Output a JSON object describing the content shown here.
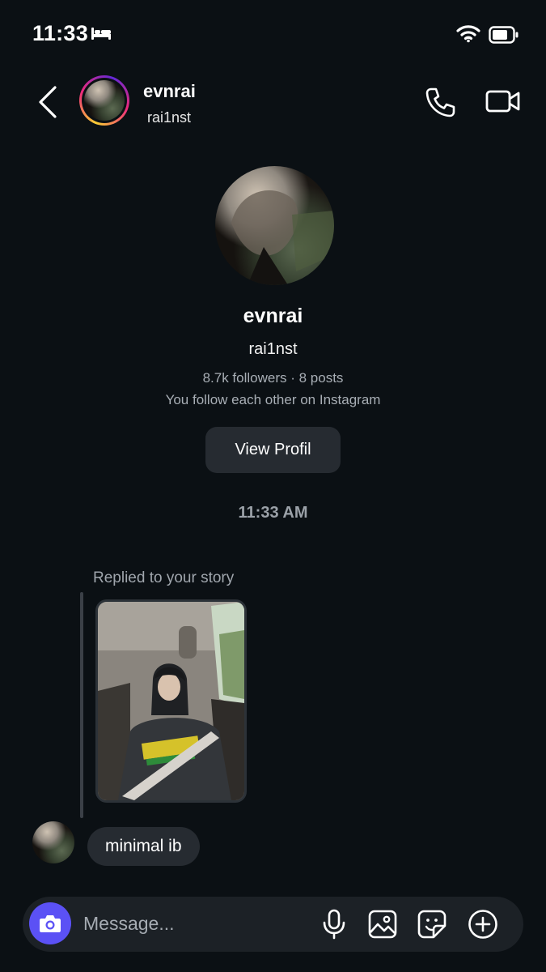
{
  "status_bar": {
    "time": "11:33",
    "icons": [
      "bed-icon",
      "wifi-icon",
      "battery-icon"
    ]
  },
  "header": {
    "back_icon": "chevron-left-icon",
    "name": "evnrai",
    "username": "rai1nst",
    "actions": [
      "phone-icon",
      "video-camera-icon"
    ]
  },
  "profile": {
    "name": "evnrai",
    "username": "rai1nst",
    "stats": "8.7k followers · 8 posts",
    "mutual": "You follow each other on Instagram",
    "view_profile_label": "View Profil"
  },
  "conversation": {
    "timestamp": "11:33 AM",
    "reply_label": "Replied to your story",
    "message": "minimal ib"
  },
  "composer": {
    "placeholder": "Message...",
    "icons": [
      "camera-icon",
      "microphone-icon",
      "gallery-icon",
      "sticker-icon",
      "plus-circle-icon"
    ]
  },
  "colors": {
    "background": "#0b1014",
    "bubble": "#262b31",
    "camera_button": "#5b51f5",
    "secondary_text": "#a8aeb5"
  }
}
